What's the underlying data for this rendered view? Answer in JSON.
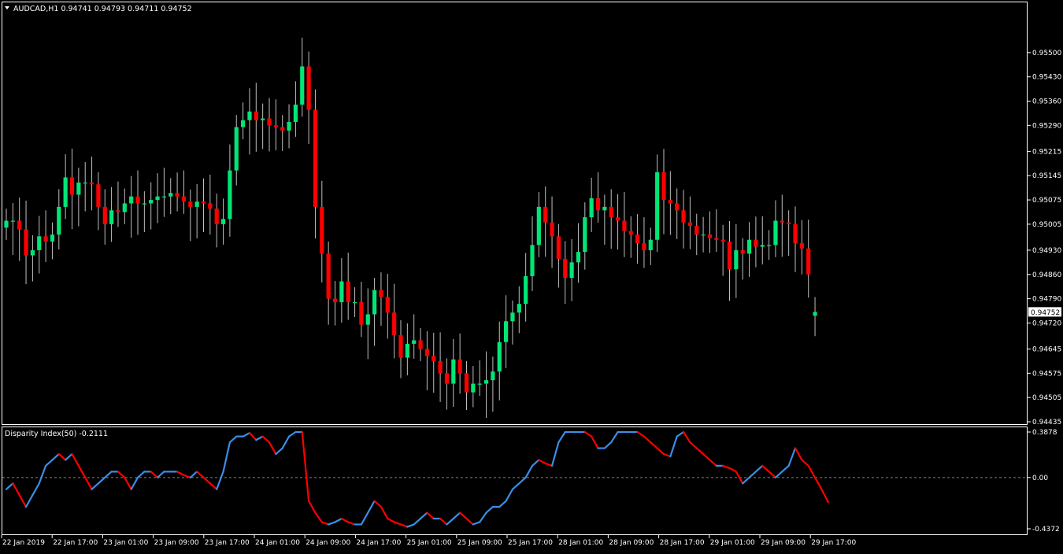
{
  "window": {
    "symbol_info": "AUDCAD,H1  0.94741 0.94793 0.94711 0.94752",
    "dropdown_icon": "triangle-down-icon"
  },
  "colors": {
    "background": "#000000",
    "frame": "#ffffff",
    "bull": "#00e676",
    "bear": "#ff0000",
    "wick": "#bfbfbf",
    "disparity_up": "#3a8ee6",
    "disparity_down": "#ff0000",
    "zero_line": "#808080"
  },
  "chart_data": [
    {
      "type": "candlestick",
      "title": "AUDCAD,H1",
      "symbol": "AUDCAD",
      "timeframe": "H1",
      "last_bar": {
        "open": 0.94741,
        "high": 0.94793,
        "low": 0.94711,
        "close": 0.94752
      },
      "current_price_label": "0.94752",
      "ylim": [
        0.94435,
        0.9557
      ],
      "y_ticks": [
        "0.95500",
        "0.95430",
        "0.95360",
        "0.95290",
        "0.95215",
        "0.95145",
        "0.95075",
        "0.95005",
        "0.94930",
        "0.94860",
        "0.94790",
        "0.94720",
        "0.94645",
        "0.94575",
        "0.94505",
        "0.94435"
      ],
      "grid": false,
      "closes": [
        0.95015,
        0.95015,
        0.9499,
        0.94915,
        0.9493,
        0.9497,
        0.94955,
        0.94975,
        0.95055,
        0.9514,
        0.9509,
        0.95125,
        0.95125,
        0.9512,
        0.95055,
        0.95005,
        0.95045,
        0.9504,
        0.95065,
        0.95085,
        0.95065,
        0.95065,
        0.95075,
        0.95085,
        0.95085,
        0.95095,
        0.95085,
        0.9507,
        0.95055,
        0.9507,
        0.95065,
        0.9505,
        0.95005,
        0.9502,
        0.9516,
        0.95285,
        0.95305,
        0.9533,
        0.95305,
        0.9531,
        0.9529,
        0.95285,
        0.95275,
        0.953,
        0.9535,
        0.9546,
        0.95335,
        0.95055,
        0.9492,
        0.9479,
        0.9478,
        0.9484,
        0.9478,
        0.9478,
        0.94715,
        0.94745,
        0.94815,
        0.94795,
        0.9475,
        0.94685,
        0.9462,
        0.9466,
        0.9467,
        0.94645,
        0.94625,
        0.9461,
        0.94575,
        0.94545,
        0.94615,
        0.94575,
        0.9452,
        0.94545,
        0.94545,
        0.94555,
        0.9458,
        0.94665,
        0.94725,
        0.9475,
        0.94775,
        0.94855,
        0.94945,
        0.95055,
        0.9501,
        0.9497,
        0.94905,
        0.9485,
        0.94895,
        0.94925,
        0.95025,
        0.9508,
        0.95045,
        0.95055,
        0.95025,
        0.95015,
        0.94985,
        0.94975,
        0.9495,
        0.9493,
        0.9496,
        0.95155,
        0.95075,
        0.95065,
        0.95045,
        0.9501,
        0.95,
        0.94975,
        0.94975,
        0.94965,
        0.9496,
        0.94955,
        0.94875,
        0.9493,
        0.9492,
        0.9496,
        0.9494,
        0.94945,
        0.94945,
        0.95015,
        0.9501,
        0.95005,
        0.9495,
        0.94935,
        0.9486,
        0.94752
      ],
      "x_tick_labels": [
        "22 Jan 2019",
        "22 Jan 17:00",
        "23 Jan 01:00",
        "23 Jan 09:00",
        "23 Jan 17:00",
        "24 Jan 01:00",
        "24 Jan 09:00",
        "24 Jan 17:00",
        "25 Jan 01:00",
        "25 Jan 09:00",
        "25 Jan 17:00",
        "28 Jan 01:00",
        "28 Jan 09:00",
        "28 Jan 17:00",
        "29 Jan 01:00",
        "29 Jan 09:00",
        "29 Jan 17:00"
      ]
    },
    {
      "type": "line",
      "title": "Disparity Index(50) -0.2111",
      "indicator": "Disparity Index(50)",
      "current_value": "-0.2111",
      "ylim": [
        -0.4372,
        0.3878
      ],
      "y_ticks": [
        "0.3878",
        "0.00",
        "-0.4372"
      ],
      "zero_line": "dashed",
      "values": [
        -0.1,
        -0.05,
        -0.15,
        -0.25,
        -0.15,
        -0.05,
        0.1,
        0.15,
        0.2,
        0.15,
        0.2,
        0.1,
        0.0,
        -0.1,
        -0.05,
        0.0,
        0.05,
        0.05,
        0.0,
        -0.1,
        0.0,
        0.05,
        0.05,
        0.0,
        0.05,
        0.05,
        0.05,
        0.02,
        0.0,
        0.05,
        0.0,
        -0.05,
        -0.1,
        0.05,
        0.3,
        0.35,
        0.35,
        0.38,
        0.32,
        0.35,
        0.3,
        0.2,
        0.25,
        0.35,
        0.45,
        0.4,
        -0.2,
        -0.3,
        -0.38,
        -0.4,
        -0.38,
        -0.35,
        -0.38,
        -0.4,
        -0.4,
        -0.3,
        -0.2,
        -0.25,
        -0.35,
        -0.38,
        -0.4,
        -0.42,
        -0.4,
        -0.35,
        -0.3,
        -0.35,
        -0.35,
        -0.4,
        -0.35,
        -0.3,
        -0.35,
        -0.4,
        -0.38,
        -0.3,
        -0.25,
        -0.25,
        -0.2,
        -0.1,
        -0.05,
        0.0,
        0.1,
        0.15,
        0.12,
        0.1,
        0.3,
        0.45,
        0.48,
        0.5,
        0.45,
        0.35,
        0.25,
        0.25,
        0.3,
        0.4,
        0.45,
        0.42,
        0.43,
        0.35,
        0.3,
        0.25,
        0.2,
        0.18,
        0.35,
        0.45,
        0.3,
        0.25,
        0.2,
        0.15,
        0.1,
        0.1,
        0.08,
        0.05,
        -0.05,
        0.0,
        0.05,
        0.1,
        0.05,
        0.0,
        0.05,
        0.1,
        0.25,
        0.15,
        0.1,
        0.0,
        -0.1,
        -0.21
      ]
    }
  ],
  "time_axis": {
    "labels": [
      "22 Jan 2019",
      "22 Jan 17:00",
      "23 Jan 01:00",
      "23 Jan 09:00",
      "23 Jan 17:00",
      "24 Jan 01:00",
      "24 Jan 09:00",
      "24 Jan 17:00",
      "25 Jan 01:00",
      "25 Jan 09:00",
      "25 Jan 17:00",
      "28 Jan 01:00",
      "28 Jan 09:00",
      "28 Jan 17:00",
      "29 Jan 01:00",
      "29 Jan 09:00",
      "29 Jan 17:00"
    ]
  }
}
